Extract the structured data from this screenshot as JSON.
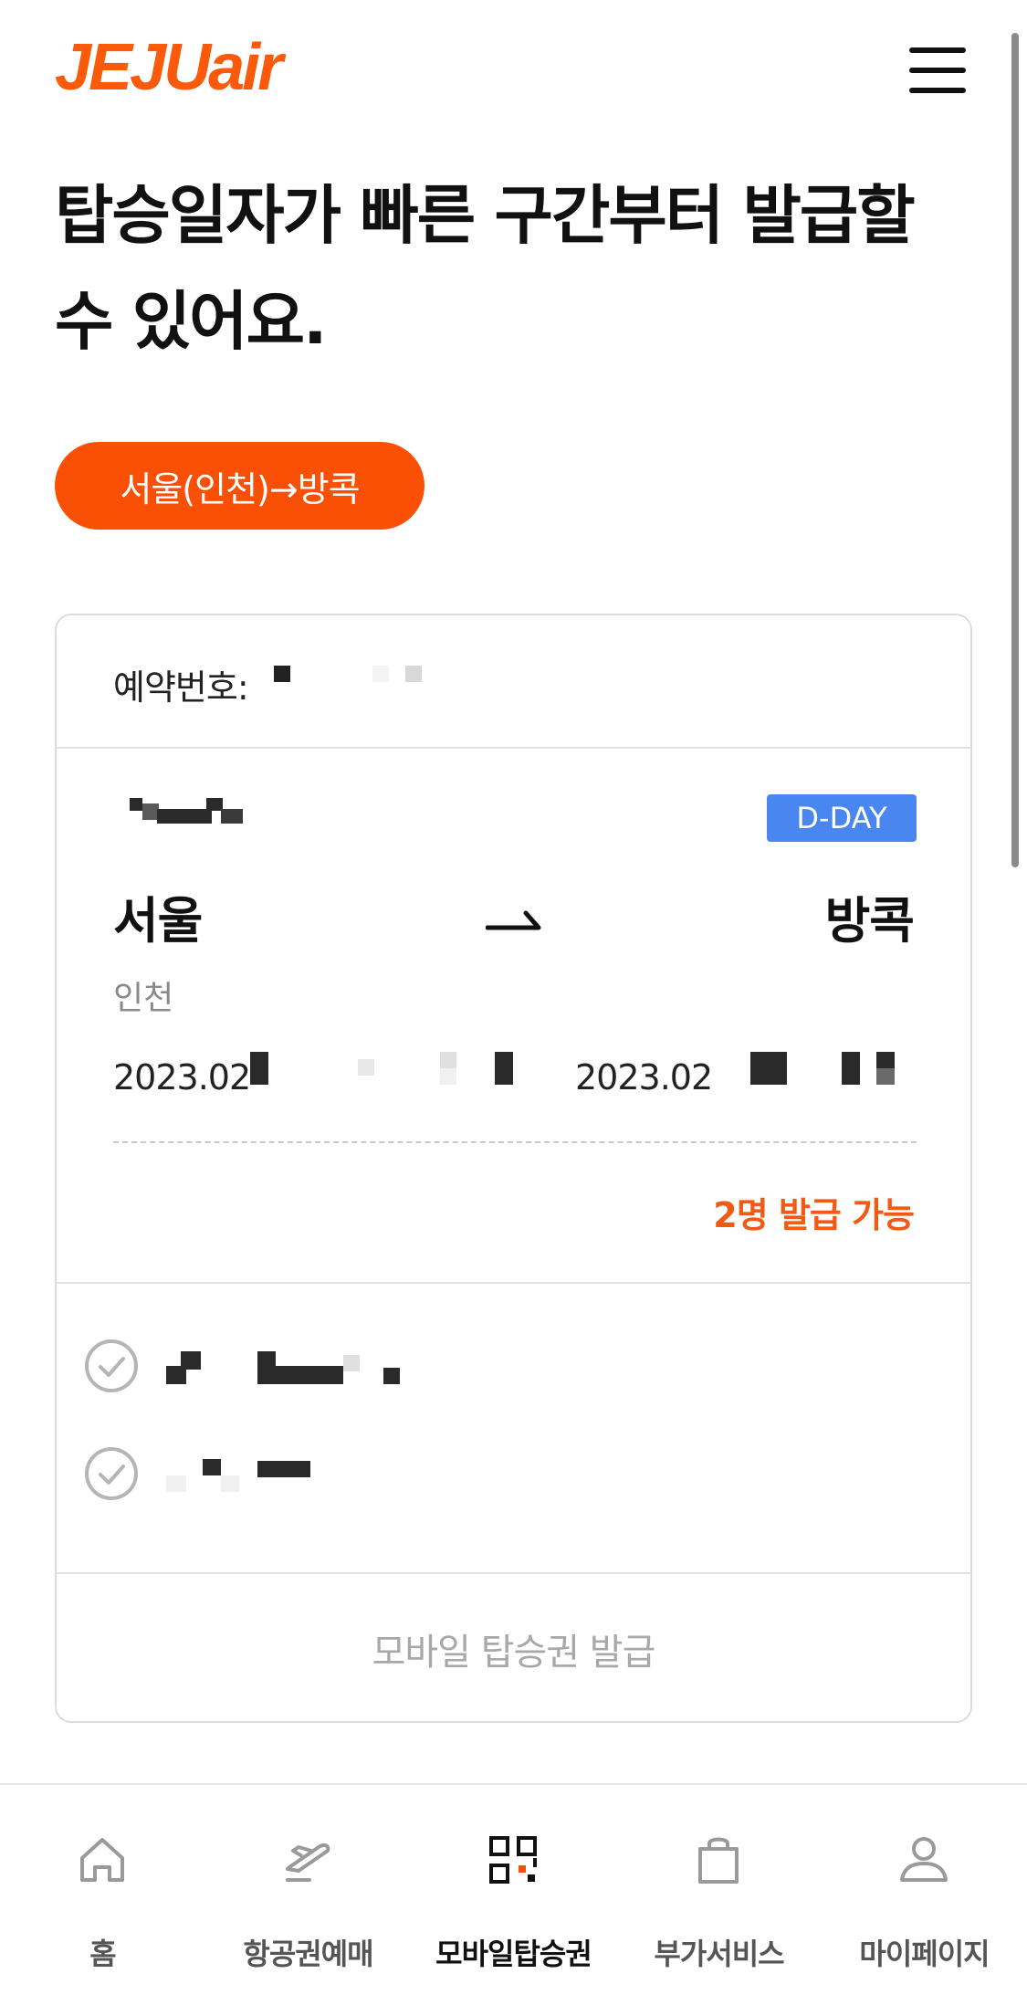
{
  "header": {
    "logo_text": "JEJUair",
    "logo_parts": {
      "main": "JEJU",
      "sub": "air",
      "dot": "•"
    },
    "menu_icon": "hamburger-menu-icon"
  },
  "headline": {
    "line1": "탑승일자가 빠른 구간부터 발급할",
    "line2": "수 있어요."
  },
  "route_chip": {
    "label": "서울(인천)→방콕"
  },
  "card": {
    "reservation_label": "예약번호:",
    "dday_badge": "D-DAY",
    "from_city": "서울",
    "to_city": "방콕",
    "from_airport": "인천",
    "depart_date_visible": "2023.02",
    "arrive_date_visible": "2023.02",
    "issue_count_text": "2명 발급 가능",
    "passengers": [
      {
        "checked": true
      },
      {
        "checked": true
      }
    ],
    "issue_button_label": "모바일 탑승권 발급"
  },
  "bottom_nav": {
    "items": [
      {
        "label": "홈",
        "icon": "home-icon"
      },
      {
        "label": "항공권예매",
        "icon": "airplane-ticket-icon"
      },
      {
        "label": "모바일탑승권",
        "icon": "qr-code-icon",
        "active": true
      },
      {
        "label": "부가서비스",
        "icon": "shopping-bag-icon"
      },
      {
        "label": "마이페이지",
        "icon": "user-icon"
      }
    ]
  },
  "colors": {
    "brand_orange": "#fa5005",
    "dday_blue": "#4a86f0",
    "issue_count_orange": "#f05a14",
    "disabled_gray": "#a8a8a8"
  }
}
